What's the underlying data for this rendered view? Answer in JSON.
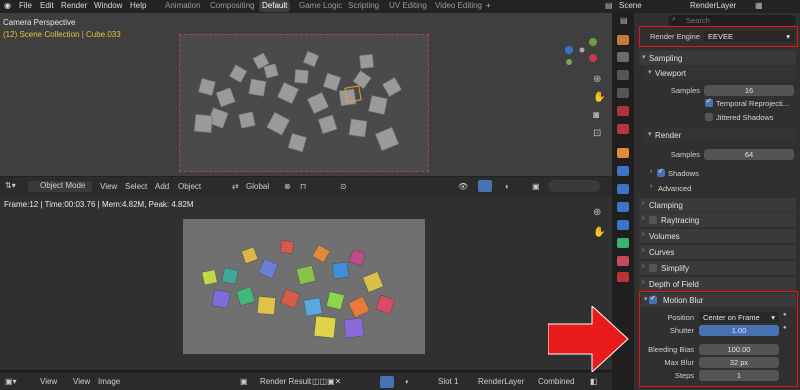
{
  "menu": [
    "File",
    "Edit",
    "Render",
    "Window",
    "Help"
  ],
  "workspaces": [
    "Animation",
    "Compositing",
    "Default",
    "Game Logic",
    "Scripting",
    "UV Editing",
    "Video Editing"
  ],
  "active_workspace": "Default",
  "scene": "Scene",
  "render_layer": "RenderLayer",
  "search_placeholder": "Search",
  "viewport": {
    "title": "Camera Perspective",
    "collection": "(12) Scene Collection | Cube.033",
    "header": {
      "mode": "Object Mode",
      "view": "View",
      "select": "Select",
      "add": "Add",
      "object": "Object",
      "orientation": "Global"
    }
  },
  "render_view": {
    "status": "Frame:12 | Time:00:03.76 | Mem:4.82M, Peak: 4.82M",
    "header": {
      "view1": "View",
      "view2": "View",
      "image": "Image",
      "result": "Render Result",
      "slot": "Slot 1",
      "layer": "RenderLayer",
      "pass": "Combined"
    }
  },
  "properties": {
    "render_engine_label": "Render Engine",
    "render_engine": "EEVEE",
    "sampling": "Sampling",
    "viewport_sub": "Viewport",
    "samples_label": "Samples",
    "viewport_samples": "16",
    "temporal": "Temporal Reprojecti...",
    "jittered": "Jittered Shadows",
    "render_sub": "Render",
    "render_samples": "64",
    "shadows": "Shadows",
    "advanced": "Advanced",
    "clamping": "Clamping",
    "raytracing": "Raytracing",
    "volumes": "Volumes",
    "curves": "Curves",
    "simplify": "Simplify",
    "dof": "Depth of Field",
    "motion_blur": "Motion Blur",
    "position_label": "Position",
    "position": "Center on Frame",
    "shutter_label": "Shutter",
    "shutter": "1.00",
    "bleeding_label": "Bleeding Bias",
    "bleeding": "100.00",
    "maxblur_label": "Max Blur",
    "maxblur": "32 px",
    "steps_label": "Steps",
    "steps": "1"
  },
  "colors": {
    "accent": "#4772b3",
    "highlight": "#ee1111"
  }
}
